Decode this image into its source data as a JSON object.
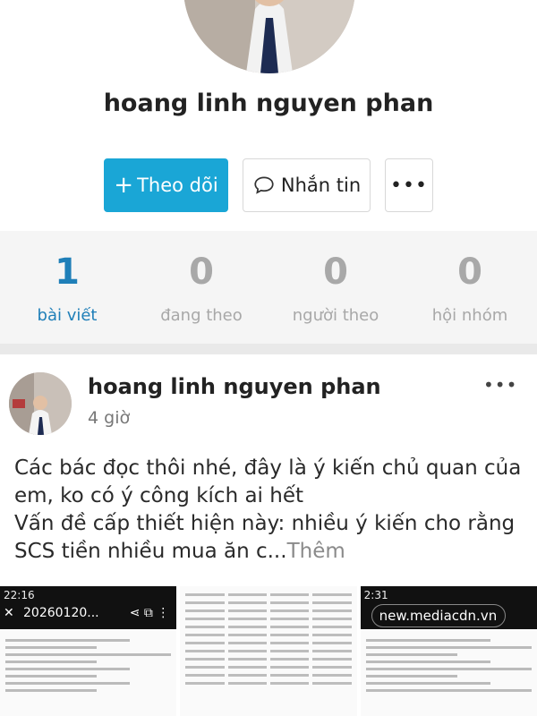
{
  "profile": {
    "name": "hoang linh nguyen phan"
  },
  "actions": {
    "follow_label": "Theo dõi",
    "follow_icon": "plus-icon",
    "message_label": "Nhắn tin",
    "message_icon": "chat-bubble-icon",
    "more_label": "•••"
  },
  "stats": [
    {
      "value": "1",
      "label": "bài viết"
    },
    {
      "value": "0",
      "label": "đang theo"
    },
    {
      "value": "0",
      "label": "người theo"
    },
    {
      "value": "0",
      "label": "hội nhóm"
    }
  ],
  "post": {
    "author": "hoang linh nguyen phan",
    "time": "4 giờ",
    "more_label": "•••",
    "text_line1": "Các bác đọc thôi nhé, đây là ý kiến chủ quan của em, ko có ý công kích ai hết",
    "text_line2": "Vấn đề cấp thiết hiện này: nhiều ý kiến cho rằng SCS tiền nhiều mua ăn c...",
    "see_more": "Thêm"
  },
  "thumbnails": [
    {
      "status_time": "22:16",
      "url": "20260120...",
      "close": "✕",
      "icons": "⋖ ⧉ ⋮"
    },
    {},
    {
      "status_time": "2:31",
      "url": "new.mediacdn.vn"
    }
  ],
  "colors": {
    "accent": "#1aa6d6",
    "active_stat": "#1f7fb8",
    "muted": "#a8a8a8"
  }
}
